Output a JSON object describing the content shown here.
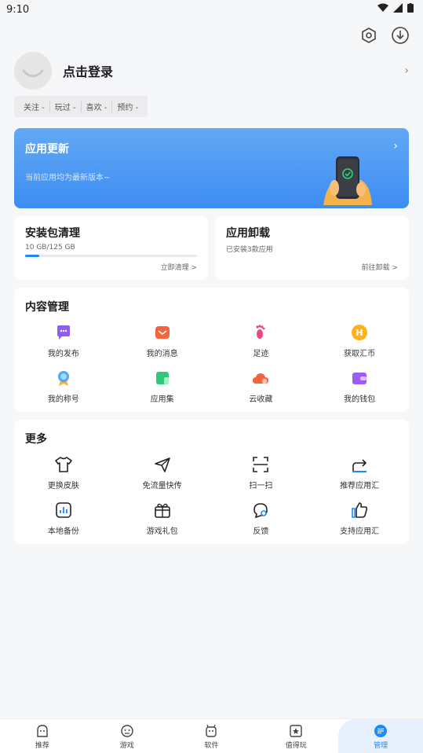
{
  "status_bar": {
    "time": "9:10"
  },
  "profile": {
    "login_label": "点击登录"
  },
  "stats": [
    "关注 -",
    "玩过 -",
    "喜欢 -",
    "预约 -"
  ],
  "banner": {
    "title": "应用更新",
    "subtitle": "当前应用均为最新版本~"
  },
  "package_clean": {
    "title": "安装包清理",
    "usage": "10 GB/125 GB",
    "usage_fraction": 0.08,
    "link": "立即清理 >"
  },
  "uninstall": {
    "title": "应用卸载",
    "subtitle": "已安装3款应用",
    "link": "前往卸载 >"
  },
  "content_mgmt": {
    "title": "内容管理",
    "items": [
      {
        "label": "我的发布",
        "icon": "chat-bubble-icon"
      },
      {
        "label": "我的消息",
        "icon": "mail-icon"
      },
      {
        "label": "足迹",
        "icon": "footprint-icon"
      },
      {
        "label": "获取汇币",
        "icon": "coin-icon"
      },
      {
        "label": "我的称号",
        "icon": "badge-icon"
      },
      {
        "label": "应用集",
        "icon": "app-collection-icon"
      },
      {
        "label": "云收藏",
        "icon": "cloud-icon"
      },
      {
        "label": "我的钱包",
        "icon": "wallet-icon"
      }
    ]
  },
  "more": {
    "title": "更多",
    "items": [
      {
        "label": "更换皮肤",
        "icon": "tshirt-icon"
      },
      {
        "label": "免流量快传",
        "icon": "paper-plane-icon"
      },
      {
        "label": "扫一扫",
        "icon": "scan-icon"
      },
      {
        "label": "推荐应用汇",
        "icon": "share-icon"
      },
      {
        "label": "本地备份",
        "icon": "backup-icon"
      },
      {
        "label": "游戏礼包",
        "icon": "gift-icon"
      },
      {
        "label": "反馈",
        "icon": "feedback-icon"
      },
      {
        "label": "支持应用汇",
        "icon": "thumbs-up-icon"
      }
    ]
  },
  "tabs": [
    {
      "label": "推荐",
      "icon": "recommend-icon"
    },
    {
      "label": "游戏",
      "icon": "game-icon"
    },
    {
      "label": "软件",
      "icon": "software-icon"
    },
    {
      "label": "值得玩",
      "icon": "star-icon"
    },
    {
      "label": "管理",
      "icon": "manage-icon"
    }
  ],
  "colors": {
    "accent": "#1f8af5",
    "banner_top": "#62a8f5",
    "banner_bottom": "#3d8df2"
  }
}
